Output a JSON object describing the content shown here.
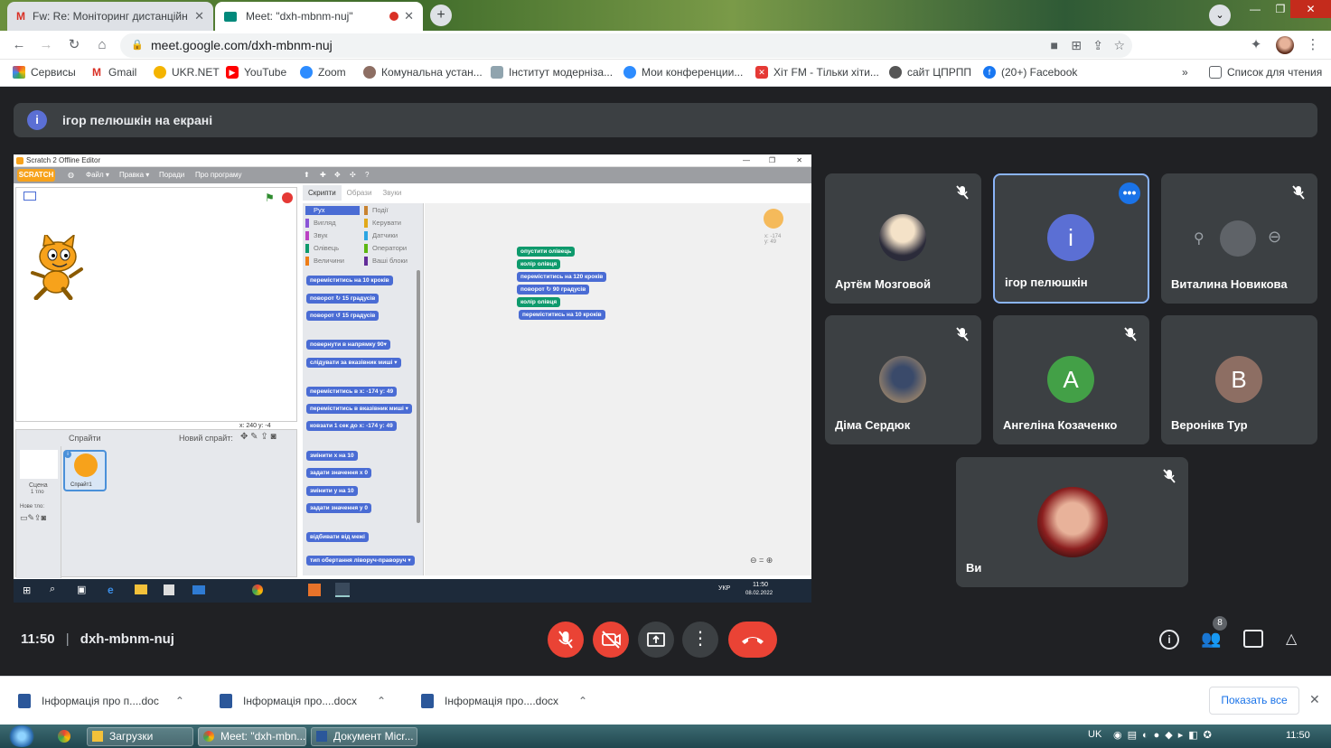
{
  "browser": {
    "tabs": [
      {
        "title": "Fw: Re: Моніторинг дистанційн",
        "icon": "gmail-icon"
      },
      {
        "title": "Meet: \"dxh-mbnm-nuj\"",
        "icon": "meet-icon"
      }
    ],
    "url": "meet.google.com/dxh-mbnm-nuj",
    "bookmarks": [
      "Сервисы",
      "Gmail",
      "UKR.NET",
      "YouTube",
      "Zoom",
      "Комунальна устан...",
      "Інститут модерніза...",
      "Мои конференции...",
      "Хіт FM - Тільки хіти...",
      "сайт ЦПРПП",
      "(20+) Facebook"
    ],
    "reading_list": "Список для чтения",
    "more": "»"
  },
  "meet": {
    "banner": "ігор пелюшкін на екрані",
    "banner_icon": "i",
    "time": "11:50",
    "separator": "|",
    "meeting_code": "dxh-mbnm-nuj",
    "people_count": "8",
    "participants": [
      {
        "name": "Артём Мозговой",
        "avatar": "photo",
        "muted": true
      },
      {
        "name": "ігор пелюшкін",
        "avatar": "i",
        "color": "#5b6fd4",
        "muted": false,
        "active": true
      },
      {
        "name": "Виталина Новикова",
        "avatar": "photo",
        "muted": true
      },
      {
        "name": "Діма Сердюк",
        "avatar": "photo",
        "muted": true
      },
      {
        "name": "Ангеліна Козаченко",
        "avatar": "A",
        "color": "#43a047",
        "muted": true
      },
      {
        "name": "Веронікв Тур",
        "avatar": "B",
        "color": "#8d6e63",
        "muted": false
      },
      {
        "name": "Ви",
        "avatar": "photo",
        "muted": true
      }
    ]
  },
  "scratch": {
    "window_title": "Scratch 2 Offline Editor",
    "menu": [
      "Файл ▾",
      "Правка ▾",
      "Поради",
      "Про програму"
    ],
    "tabs": [
      "Скрипти",
      "Образи",
      "Звуки"
    ],
    "categories_left": [
      "Рух",
      "Вигляд",
      "Звук",
      "Олівець",
      "Величини"
    ],
    "categories_right": [
      "Події",
      "Керувати",
      "Датчики",
      "Оператори",
      "Ваші блоки"
    ],
    "palette_blocks": [
      "переміститись на 10 кроків",
      "поворот ↻ 15 градусів",
      "поворот ↺ 15 градусів",
      "повернути в напрямку 90▾",
      "слідувати за вказівник миші ▾",
      "переміститись в x: -174 y: 49",
      "переміститись в вказівник миші ▾",
      "ковзати 1 сек до x: -174 y: 49",
      "змінити x на 10",
      "задати значення x 0",
      "змінити у на 10",
      "задати значення у 0",
      "відбивати від межі",
      "тип обертання ліворуч-праворуч ▾"
    ],
    "script_blocks": [
      "опустити олівець",
      "колір олівця",
      "переміститись на 120 кроків",
      "поворот ↻ 90 градусів",
      "колір олівця",
      "переміститись на 10 кроків"
    ],
    "coords": "x: 240  y: -4",
    "sprite_coords": "x: -174\ny: 49",
    "sprites_label": "Спрайти",
    "new_sprite": "Новий спрайт:",
    "stage_label": "Сцена",
    "stage_sub": "1 тло",
    "new_backdrop": "Нове тло:",
    "sprite_name": "Спрайт1",
    "inner_clock": "11:50",
    "inner_date": "08.02.2022",
    "inner_lang": "УКР"
  },
  "downloads": {
    "items": [
      "Інформація про п....doc",
      "Інформація про....docx",
      "Інформація про....docx"
    ],
    "show_all": "Показать все"
  },
  "windows_taskbar": {
    "items": [
      "Загрузки",
      "Meet: \"dxh-mbn...",
      "Документ Micr..."
    ],
    "lang": "UK",
    "clock": "11:50"
  }
}
